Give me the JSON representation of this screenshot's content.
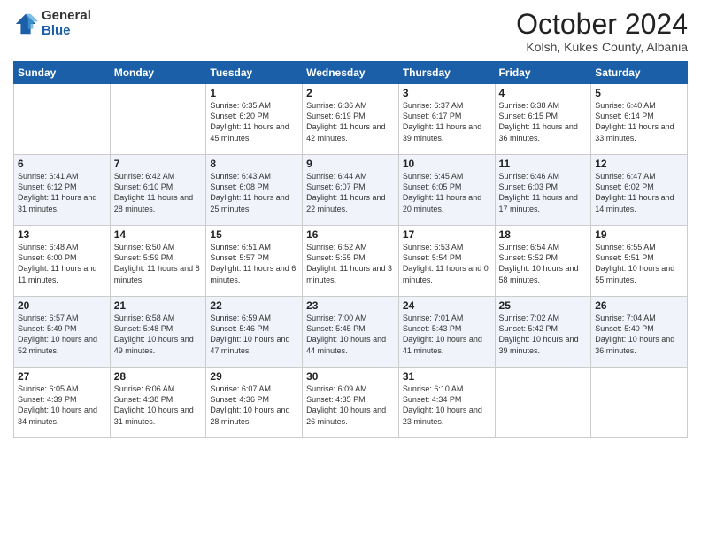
{
  "header": {
    "logo_general": "General",
    "logo_blue": "Blue",
    "month": "October 2024",
    "location": "Kolsh, Kukes County, Albania"
  },
  "days_of_week": [
    "Sunday",
    "Monday",
    "Tuesday",
    "Wednesday",
    "Thursday",
    "Friday",
    "Saturday"
  ],
  "weeks": [
    [
      {
        "day": "",
        "sunrise": "",
        "sunset": "",
        "daylight": ""
      },
      {
        "day": "",
        "sunrise": "",
        "sunset": "",
        "daylight": ""
      },
      {
        "day": "1",
        "sunrise": "Sunrise: 6:35 AM",
        "sunset": "Sunset: 6:20 PM",
        "daylight": "Daylight: 11 hours and 45 minutes."
      },
      {
        "day": "2",
        "sunrise": "Sunrise: 6:36 AM",
        "sunset": "Sunset: 6:19 PM",
        "daylight": "Daylight: 11 hours and 42 minutes."
      },
      {
        "day": "3",
        "sunrise": "Sunrise: 6:37 AM",
        "sunset": "Sunset: 6:17 PM",
        "daylight": "Daylight: 11 hours and 39 minutes."
      },
      {
        "day": "4",
        "sunrise": "Sunrise: 6:38 AM",
        "sunset": "Sunset: 6:15 PM",
        "daylight": "Daylight: 11 hours and 36 minutes."
      },
      {
        "day": "5",
        "sunrise": "Sunrise: 6:40 AM",
        "sunset": "Sunset: 6:14 PM",
        "daylight": "Daylight: 11 hours and 33 minutes."
      }
    ],
    [
      {
        "day": "6",
        "sunrise": "Sunrise: 6:41 AM",
        "sunset": "Sunset: 6:12 PM",
        "daylight": "Daylight: 11 hours and 31 minutes."
      },
      {
        "day": "7",
        "sunrise": "Sunrise: 6:42 AM",
        "sunset": "Sunset: 6:10 PM",
        "daylight": "Daylight: 11 hours and 28 minutes."
      },
      {
        "day": "8",
        "sunrise": "Sunrise: 6:43 AM",
        "sunset": "Sunset: 6:08 PM",
        "daylight": "Daylight: 11 hours and 25 minutes."
      },
      {
        "day": "9",
        "sunrise": "Sunrise: 6:44 AM",
        "sunset": "Sunset: 6:07 PM",
        "daylight": "Daylight: 11 hours and 22 minutes."
      },
      {
        "day": "10",
        "sunrise": "Sunrise: 6:45 AM",
        "sunset": "Sunset: 6:05 PM",
        "daylight": "Daylight: 11 hours and 20 minutes."
      },
      {
        "day": "11",
        "sunrise": "Sunrise: 6:46 AM",
        "sunset": "Sunset: 6:03 PM",
        "daylight": "Daylight: 11 hours and 17 minutes."
      },
      {
        "day": "12",
        "sunrise": "Sunrise: 6:47 AM",
        "sunset": "Sunset: 6:02 PM",
        "daylight": "Daylight: 11 hours and 14 minutes."
      }
    ],
    [
      {
        "day": "13",
        "sunrise": "Sunrise: 6:48 AM",
        "sunset": "Sunset: 6:00 PM",
        "daylight": "Daylight: 11 hours and 11 minutes."
      },
      {
        "day": "14",
        "sunrise": "Sunrise: 6:50 AM",
        "sunset": "Sunset: 5:59 PM",
        "daylight": "Daylight: 11 hours and 8 minutes."
      },
      {
        "day": "15",
        "sunrise": "Sunrise: 6:51 AM",
        "sunset": "Sunset: 5:57 PM",
        "daylight": "Daylight: 11 hours and 6 minutes."
      },
      {
        "day": "16",
        "sunrise": "Sunrise: 6:52 AM",
        "sunset": "Sunset: 5:55 PM",
        "daylight": "Daylight: 11 hours and 3 minutes."
      },
      {
        "day": "17",
        "sunrise": "Sunrise: 6:53 AM",
        "sunset": "Sunset: 5:54 PM",
        "daylight": "Daylight: 11 hours and 0 minutes."
      },
      {
        "day": "18",
        "sunrise": "Sunrise: 6:54 AM",
        "sunset": "Sunset: 5:52 PM",
        "daylight": "Daylight: 10 hours and 58 minutes."
      },
      {
        "day": "19",
        "sunrise": "Sunrise: 6:55 AM",
        "sunset": "Sunset: 5:51 PM",
        "daylight": "Daylight: 10 hours and 55 minutes."
      }
    ],
    [
      {
        "day": "20",
        "sunrise": "Sunrise: 6:57 AM",
        "sunset": "Sunset: 5:49 PM",
        "daylight": "Daylight: 10 hours and 52 minutes."
      },
      {
        "day": "21",
        "sunrise": "Sunrise: 6:58 AM",
        "sunset": "Sunset: 5:48 PM",
        "daylight": "Daylight: 10 hours and 49 minutes."
      },
      {
        "day": "22",
        "sunrise": "Sunrise: 6:59 AM",
        "sunset": "Sunset: 5:46 PM",
        "daylight": "Daylight: 10 hours and 47 minutes."
      },
      {
        "day": "23",
        "sunrise": "Sunrise: 7:00 AM",
        "sunset": "Sunset: 5:45 PM",
        "daylight": "Daylight: 10 hours and 44 minutes."
      },
      {
        "day": "24",
        "sunrise": "Sunrise: 7:01 AM",
        "sunset": "Sunset: 5:43 PM",
        "daylight": "Daylight: 10 hours and 41 minutes."
      },
      {
        "day": "25",
        "sunrise": "Sunrise: 7:02 AM",
        "sunset": "Sunset: 5:42 PM",
        "daylight": "Daylight: 10 hours and 39 minutes."
      },
      {
        "day": "26",
        "sunrise": "Sunrise: 7:04 AM",
        "sunset": "Sunset: 5:40 PM",
        "daylight": "Daylight: 10 hours and 36 minutes."
      }
    ],
    [
      {
        "day": "27",
        "sunrise": "Sunrise: 6:05 AM",
        "sunset": "Sunset: 4:39 PM",
        "daylight": "Daylight: 10 hours and 34 minutes."
      },
      {
        "day": "28",
        "sunrise": "Sunrise: 6:06 AM",
        "sunset": "Sunset: 4:38 PM",
        "daylight": "Daylight: 10 hours and 31 minutes."
      },
      {
        "day": "29",
        "sunrise": "Sunrise: 6:07 AM",
        "sunset": "Sunset: 4:36 PM",
        "daylight": "Daylight: 10 hours and 28 minutes."
      },
      {
        "day": "30",
        "sunrise": "Sunrise: 6:09 AM",
        "sunset": "Sunset: 4:35 PM",
        "daylight": "Daylight: 10 hours and 26 minutes."
      },
      {
        "day": "31",
        "sunrise": "Sunrise: 6:10 AM",
        "sunset": "Sunset: 4:34 PM",
        "daylight": "Daylight: 10 hours and 23 minutes."
      },
      {
        "day": "",
        "sunrise": "",
        "sunset": "",
        "daylight": ""
      },
      {
        "day": "",
        "sunrise": "",
        "sunset": "",
        "daylight": ""
      }
    ]
  ]
}
